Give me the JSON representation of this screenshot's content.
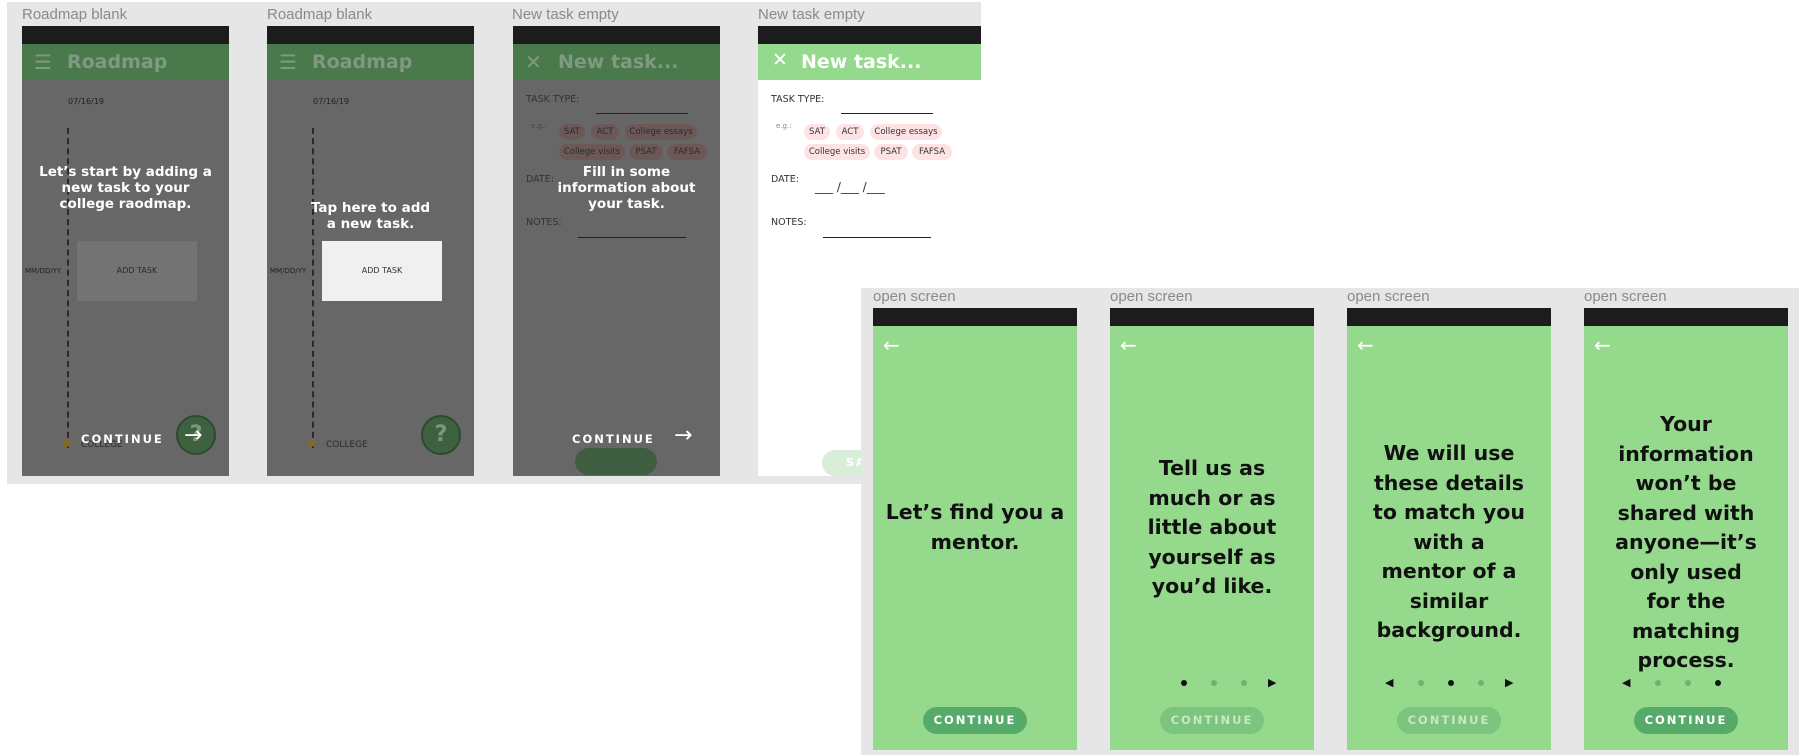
{
  "top_row": {
    "frames": [
      {
        "label": "Roadmap blank",
        "appbar_icon": "menu-icon",
        "appbar_glyph": "☰",
        "title": "Roadmap",
        "date": "07/16/19",
        "date_placeholder": "MM/DD/YY",
        "add_task_label": "ADD TASK",
        "overlay_text": "Let’s start by adding a new task to your college raodmap.",
        "milestone_label": "COLLEGE",
        "continue_label": "CONTINUE",
        "help_icon": "help-icon"
      },
      {
        "label": "Roadmap blank",
        "appbar_icon": "menu-icon",
        "appbar_glyph": "☰",
        "title": "Roadmap",
        "date": "07/16/19",
        "date_placeholder": "MM/DD/YY",
        "add_task_label": "ADD TASK",
        "overlay_text": "Tap here to add a new task.",
        "milestone_label": "COLLEGE",
        "help_icon": "help-icon"
      },
      {
        "label": "New task empty",
        "appbar_icon": "close-icon",
        "appbar_glyph": "✕",
        "title": "New task...",
        "task_type_label": "TASK TYPE:",
        "eg_label": "e.g.:",
        "chips": [
          "SAT",
          "ACT",
          "College essays",
          "College visits",
          "PSAT",
          "FAFSA"
        ],
        "date_label": "DATE:",
        "notes_label": "NOTES:",
        "overlay_text": "Fill in some information about your task.",
        "continue_label": "CONTINUE"
      },
      {
        "label": "New task empty",
        "appbar_icon": "close-icon",
        "appbar_glyph": "✕",
        "title": "New task...",
        "task_type_label": "TASK TYPE:",
        "eg_label": "e.g.:",
        "chips": [
          "SAT",
          "ACT",
          "College essays",
          "College visits",
          "PSAT",
          "FAFSA"
        ],
        "date_label": "DATE:",
        "date_value": "___ /___ /___",
        "notes_label": "NOTES:",
        "save_label": "SA"
      }
    ]
  },
  "bottom_row": {
    "frames": [
      {
        "label": "open screen",
        "back_icon": "back-arrow-icon",
        "message": "Let’s find you a mentor.",
        "continue_label": "CONTINUE",
        "continue_enabled": true,
        "dots": []
      },
      {
        "label": "open screen",
        "back_icon": "back-arrow-icon",
        "message": "Tell us as much or as little about yourself as you’d like.",
        "continue_label": "CONTINUE",
        "continue_enabled": false,
        "dots": [
          "on",
          "off",
          "off"
        ],
        "prev_arrow": false,
        "next_arrow": true
      },
      {
        "label": "open screen",
        "back_icon": "back-arrow-icon",
        "message": "We will use these details to match you with a mentor of a similar background.",
        "continue_label": "CONTINUE",
        "continue_enabled": false,
        "dots": [
          "off",
          "on",
          "off"
        ],
        "prev_arrow": true,
        "next_arrow": true
      },
      {
        "label": "open screen",
        "back_icon": "back-arrow-icon",
        "message": "Your information won’t be shared with anyone—it’s only used for the matching process.",
        "continue_label": "CONTINUE",
        "continue_enabled": true,
        "dots": [
          "off",
          "off",
          "on"
        ],
        "prev_arrow": true,
        "next_arrow": false
      }
    ]
  },
  "colors": {
    "board": "#e6e6e7",
    "brand_green": "#94d98c",
    "button_green": "#57ab6a",
    "dim_overlay": "#676767",
    "chip_pink": "#fde3e3"
  }
}
